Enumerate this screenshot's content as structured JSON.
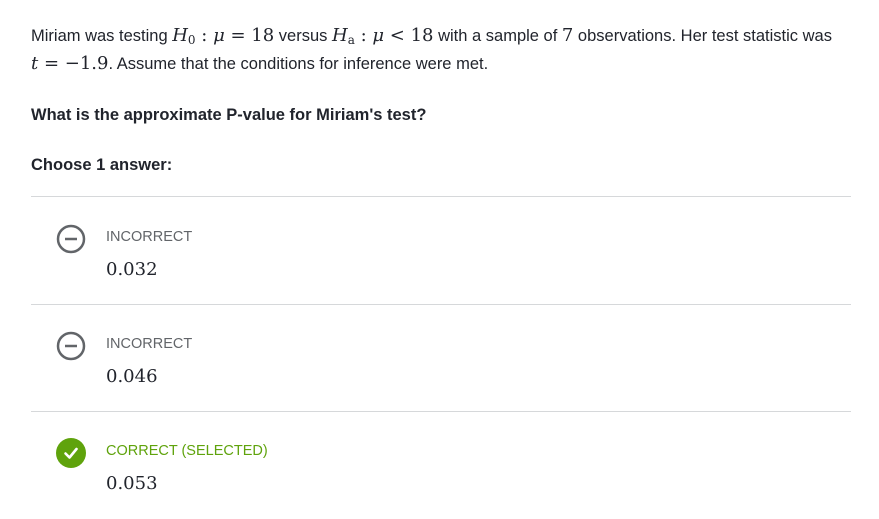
{
  "question": {
    "text_1": "Miriam was testing ",
    "null_hypothesis": "H₀ : μ = 18",
    "text_2": " versus ",
    "alt_hypothesis": "Hₐ : μ < 18",
    "text_3": " with a sample of ",
    "sample_size": "7",
    "text_4": " observations. Her test statistic was ",
    "test_statistic": "t = −1.9",
    "text_5": ". Assume that the conditions for inference were met."
  },
  "prompt": "What is the approximate P-value for Miriam's test?",
  "choose_label": "Choose 1 answer:",
  "choices": [
    {
      "status": "INCORRECT",
      "value": "0.032",
      "icon": "minus-circle-icon"
    },
    {
      "status": "INCORRECT",
      "value": "0.046",
      "icon": "minus-circle-icon"
    },
    {
      "status": "CORRECT (SELECTED)",
      "value": "0.053",
      "icon": "check-circle-icon"
    }
  ],
  "colors": {
    "text": "#21242c",
    "muted": "#626569",
    "correct": "#5fa30c",
    "divider": "#d6d8da"
  }
}
